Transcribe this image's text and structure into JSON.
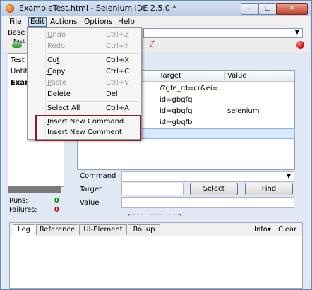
{
  "window": {
    "title": "ExampleTest.html - Selenium IDE 2.5.0 *",
    "min_label": "–",
    "max_label": "▢",
    "close_label": "✕"
  },
  "menubar": {
    "file": {
      "label": "File",
      "u": "F",
      "rest": "ile"
    },
    "edit": {
      "label": "Edit",
      "u": "E",
      "rest": "dit"
    },
    "actions": {
      "label": "Actions",
      "u": "A",
      "rest": "ctions"
    },
    "options": {
      "label": "Options",
      "u": "O",
      "rest": "ptions"
    },
    "help": {
      "label": "Help"
    }
  },
  "base_url": {
    "label": "Base",
    "value": ""
  },
  "toolbar": {
    "fast_label": "Fast"
  },
  "test_case_panel": {
    "items": [
      "Test",
      "Untit",
      "Exar"
    ]
  },
  "stats": {
    "runs_label": "Runs:",
    "runs_value": "0",
    "failures_label": "Failures:",
    "failures_value": "0"
  },
  "table": {
    "columns": [
      "Target",
      "Value"
    ],
    "rows": [
      {
        "target": "/?gfe_rd=cr&ei=...",
        "value": ""
      },
      {
        "target": "id=gbqfq",
        "value": ""
      },
      {
        "target": "id=gbqfq",
        "value": "selenium"
      },
      {
        "target": "id=gbqfb",
        "value": ""
      }
    ]
  },
  "form": {
    "command_label": "Command",
    "target_label": "Target",
    "value_label": "Value",
    "select_button": "Select",
    "find_button": "Find"
  },
  "bottom_panel": {
    "tabs": [
      "Log",
      "Reference",
      "UI-Element",
      "Rollup"
    ],
    "info_label": "Info▾",
    "clear_label": "Clear"
  },
  "edit_menu": {
    "items": [
      {
        "u": "U",
        "rest": "ndo",
        "shortcut": "Ctrl+Z",
        "enabled": false
      },
      {
        "u": "R",
        "rest": "edo",
        "shortcut": "Ctrl+Y",
        "enabled": false
      },
      {
        "pre": "Cu",
        "u": "t",
        "rest": "",
        "shortcut": "Ctrl+X",
        "enabled": true
      },
      {
        "u": "C",
        "rest": "opy",
        "shortcut": "Ctrl+C",
        "enabled": true
      },
      {
        "u": "P",
        "rest": "aste",
        "shortcut": "Ctrl+V",
        "enabled": false
      },
      {
        "u": "D",
        "rest": "elete",
        "shortcut": "Del",
        "enabled": true
      },
      {
        "pre": "Select ",
        "u": "A",
        "rest": "ll",
        "shortcut": "Ctrl+A",
        "enabled": true
      },
      {
        "pre": "",
        "u": "I",
        "rest": "nsert New Command",
        "shortcut": "",
        "enabled": true
      },
      {
        "pre": "Insert New Co",
        "u": "m",
        "rest": "ment",
        "shortcut": "",
        "enabled": true
      }
    ]
  },
  "colors": {
    "highlight_border": "#8a1f2a",
    "runs_color": "#008000",
    "failures_color": "#c00000"
  }
}
